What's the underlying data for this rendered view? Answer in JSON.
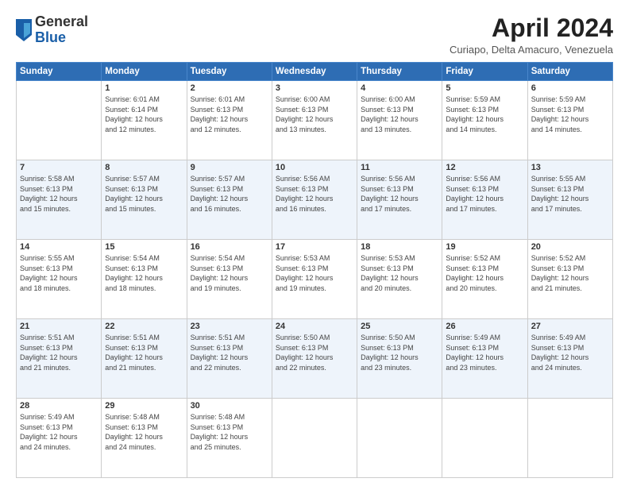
{
  "header": {
    "logo": {
      "general": "General",
      "blue": "Blue"
    },
    "title": "April 2024",
    "subtitle": "Curiapo, Delta Amacuro, Venezuela"
  },
  "days_of_week": [
    "Sunday",
    "Monday",
    "Tuesday",
    "Wednesday",
    "Thursday",
    "Friday",
    "Saturday"
  ],
  "weeks": [
    [
      {
        "day": "",
        "info": ""
      },
      {
        "day": "1",
        "info": "Sunrise: 6:01 AM\nSunset: 6:14 PM\nDaylight: 12 hours\nand 12 minutes."
      },
      {
        "day": "2",
        "info": "Sunrise: 6:01 AM\nSunset: 6:13 PM\nDaylight: 12 hours\nand 12 minutes."
      },
      {
        "day": "3",
        "info": "Sunrise: 6:00 AM\nSunset: 6:13 PM\nDaylight: 12 hours\nand 13 minutes."
      },
      {
        "day": "4",
        "info": "Sunrise: 6:00 AM\nSunset: 6:13 PM\nDaylight: 12 hours\nand 13 minutes."
      },
      {
        "day": "5",
        "info": "Sunrise: 5:59 AM\nSunset: 6:13 PM\nDaylight: 12 hours\nand 14 minutes."
      },
      {
        "day": "6",
        "info": "Sunrise: 5:59 AM\nSunset: 6:13 PM\nDaylight: 12 hours\nand 14 minutes."
      }
    ],
    [
      {
        "day": "7",
        "info": "Sunrise: 5:58 AM\nSunset: 6:13 PM\nDaylight: 12 hours\nand 15 minutes."
      },
      {
        "day": "8",
        "info": "Sunrise: 5:57 AM\nSunset: 6:13 PM\nDaylight: 12 hours\nand 15 minutes."
      },
      {
        "day": "9",
        "info": "Sunrise: 5:57 AM\nSunset: 6:13 PM\nDaylight: 12 hours\nand 16 minutes."
      },
      {
        "day": "10",
        "info": "Sunrise: 5:56 AM\nSunset: 6:13 PM\nDaylight: 12 hours\nand 16 minutes."
      },
      {
        "day": "11",
        "info": "Sunrise: 5:56 AM\nSunset: 6:13 PM\nDaylight: 12 hours\nand 17 minutes."
      },
      {
        "day": "12",
        "info": "Sunrise: 5:56 AM\nSunset: 6:13 PM\nDaylight: 12 hours\nand 17 minutes."
      },
      {
        "day": "13",
        "info": "Sunrise: 5:55 AM\nSunset: 6:13 PM\nDaylight: 12 hours\nand 17 minutes."
      }
    ],
    [
      {
        "day": "14",
        "info": "Sunrise: 5:55 AM\nSunset: 6:13 PM\nDaylight: 12 hours\nand 18 minutes."
      },
      {
        "day": "15",
        "info": "Sunrise: 5:54 AM\nSunset: 6:13 PM\nDaylight: 12 hours\nand 18 minutes."
      },
      {
        "day": "16",
        "info": "Sunrise: 5:54 AM\nSunset: 6:13 PM\nDaylight: 12 hours\nand 19 minutes."
      },
      {
        "day": "17",
        "info": "Sunrise: 5:53 AM\nSunset: 6:13 PM\nDaylight: 12 hours\nand 19 minutes."
      },
      {
        "day": "18",
        "info": "Sunrise: 5:53 AM\nSunset: 6:13 PM\nDaylight: 12 hours\nand 20 minutes."
      },
      {
        "day": "19",
        "info": "Sunrise: 5:52 AM\nSunset: 6:13 PM\nDaylight: 12 hours\nand 20 minutes."
      },
      {
        "day": "20",
        "info": "Sunrise: 5:52 AM\nSunset: 6:13 PM\nDaylight: 12 hours\nand 21 minutes."
      }
    ],
    [
      {
        "day": "21",
        "info": "Sunrise: 5:51 AM\nSunset: 6:13 PM\nDaylight: 12 hours\nand 21 minutes."
      },
      {
        "day": "22",
        "info": "Sunrise: 5:51 AM\nSunset: 6:13 PM\nDaylight: 12 hours\nand 21 minutes."
      },
      {
        "day": "23",
        "info": "Sunrise: 5:51 AM\nSunset: 6:13 PM\nDaylight: 12 hours\nand 22 minutes."
      },
      {
        "day": "24",
        "info": "Sunrise: 5:50 AM\nSunset: 6:13 PM\nDaylight: 12 hours\nand 22 minutes."
      },
      {
        "day": "25",
        "info": "Sunrise: 5:50 AM\nSunset: 6:13 PM\nDaylight: 12 hours\nand 23 minutes."
      },
      {
        "day": "26",
        "info": "Sunrise: 5:49 AM\nSunset: 6:13 PM\nDaylight: 12 hours\nand 23 minutes."
      },
      {
        "day": "27",
        "info": "Sunrise: 5:49 AM\nSunset: 6:13 PM\nDaylight: 12 hours\nand 24 minutes."
      }
    ],
    [
      {
        "day": "28",
        "info": "Sunrise: 5:49 AM\nSunset: 6:13 PM\nDaylight: 12 hours\nand 24 minutes."
      },
      {
        "day": "29",
        "info": "Sunrise: 5:48 AM\nSunset: 6:13 PM\nDaylight: 12 hours\nand 24 minutes."
      },
      {
        "day": "30",
        "info": "Sunrise: 5:48 AM\nSunset: 6:13 PM\nDaylight: 12 hours\nand 25 minutes."
      },
      {
        "day": "",
        "info": ""
      },
      {
        "day": "",
        "info": ""
      },
      {
        "day": "",
        "info": ""
      },
      {
        "day": "",
        "info": ""
      }
    ]
  ]
}
